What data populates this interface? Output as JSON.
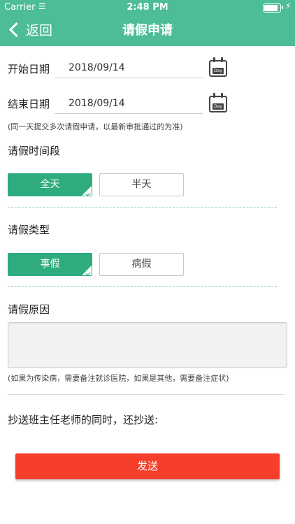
{
  "status_bar": {
    "carrier": "Carrier",
    "time": "2:48 PM",
    "battery_level": 0.95
  },
  "nav": {
    "back_label": "返回",
    "title": "请假申请"
  },
  "form": {
    "start_date_label": "开始日期",
    "start_date_value": "2018/09/14",
    "end_date_label": "结束日期",
    "end_date_value": "2018/09/14",
    "calendar_icon_text": "Day",
    "date_hint": "(同一天提交多次请假申请，以最新审批通过的为准)",
    "period_label": "请假时间段",
    "period_options": [
      "全天",
      "半天"
    ],
    "period_selected": "全天",
    "type_label": "请假类型",
    "type_options": [
      "事假",
      "病假"
    ],
    "type_selected": "事假",
    "reason_label": "请假原因",
    "reason_hint": "(如果为传染病，需要备注就诊医院，如果是其他，需要备注症状)",
    "cc_label": "抄送班主任老师的同时，还抄送:",
    "submit_label": "发送"
  },
  "colors": {
    "header": "#4cbd97",
    "selected": "#2eac7e",
    "submit": "#f53f2b",
    "dash": "#88cdb4"
  }
}
